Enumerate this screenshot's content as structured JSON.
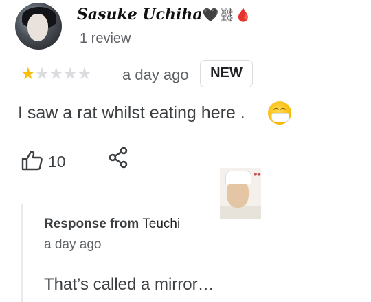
{
  "reviewer": {
    "name": "Sasuke Uchiha",
    "name_emojis": "🖤⛓🩸",
    "review_count": "1 review"
  },
  "review": {
    "rating": 1,
    "max_rating": 5,
    "stars_filled": "★",
    "stars_empty": "★★★★",
    "date": "a day ago",
    "badge": "NEW",
    "text": "I saw a rat whilst eating here .",
    "emoji_icon": "face-with-medical-mask-icon",
    "like_count": "10"
  },
  "response": {
    "from_label": "Response from",
    "owner_name": "Teuchi",
    "date": "a day ago",
    "text": "That’s called a mirror…"
  },
  "colors": {
    "star_on": "#fbbc04",
    "star_off": "#dadce0",
    "muted_text": "#5f6368"
  }
}
